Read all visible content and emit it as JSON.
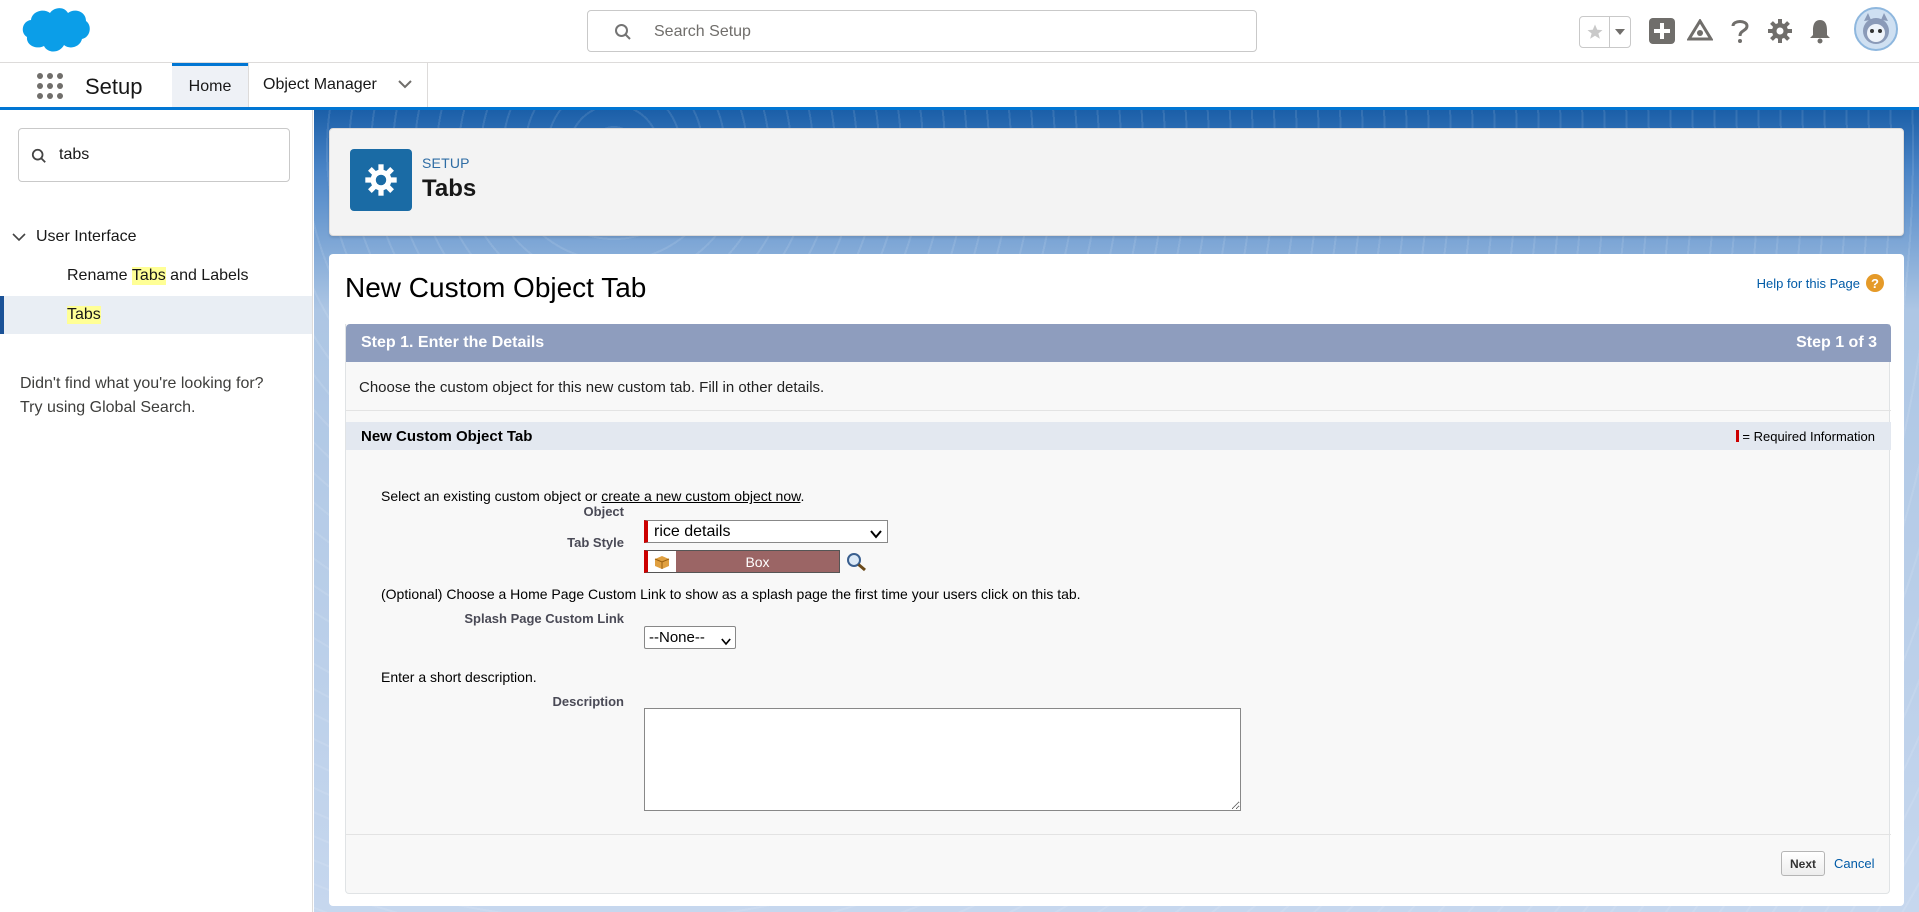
{
  "header": {
    "search_placeholder": "Search Setup",
    "icons": [
      "star-icon",
      "chevron-down-icon",
      "add-icon",
      "trailhead-icon",
      "help-icon",
      "gear-icon",
      "bell-icon",
      "avatar"
    ]
  },
  "context_bar": {
    "app_name": "Setup",
    "tabs": [
      {
        "label": "Home",
        "active": true
      },
      {
        "label": "Object Manager"
      }
    ]
  },
  "sidebar": {
    "quick_find_value": "tabs",
    "tree": {
      "parent": "User Interface",
      "items": [
        {
          "pre": "Rename ",
          "highlight": "Tabs",
          "post": " and Labels"
        },
        {
          "pre": "",
          "highlight": "Tabs",
          "post": "",
          "selected": true
        }
      ]
    },
    "note_line1": "Didn't find what you're looking for?",
    "note_line2": "Try using Global Search."
  },
  "page_header": {
    "eyebrow": "SETUP",
    "title": "Tabs"
  },
  "content": {
    "title": "New Custom Object Tab",
    "help_link": "Help for this Page",
    "help_badge": "?",
    "step": {
      "title": "Step 1. Enter the Details",
      "counter": "Step 1 of 3",
      "intro": "Choose the custom object for this new custom tab. Fill in other details."
    },
    "section": {
      "title": "New Custom Object Tab",
      "required_text": "= Required Information"
    },
    "object_prompt_pre": "Select an existing custom object or ",
    "object_prompt_link": "create a new custom object now",
    "object_prompt_post": ".",
    "object_label": "Object",
    "object_value": "rice details",
    "tab_style_label": "Tab Style",
    "tab_style_value": "Box",
    "splash_prompt": "(Optional) Choose a Home Page Custom Link to show as a splash page the first time your users click on this tab.",
    "splash_label": "Splash Page Custom Link",
    "splash_value": "--None--",
    "desc_prompt": "Enter a short description.",
    "desc_label": "Description",
    "desc_value": "",
    "next_button": "Next",
    "cancel_link": "Cancel"
  },
  "colors": {
    "brand_blue": "#0176d3",
    "step_header": "#8e9dbe",
    "required_red": "#cc0000",
    "tab_style_box": "#9b6565"
  }
}
